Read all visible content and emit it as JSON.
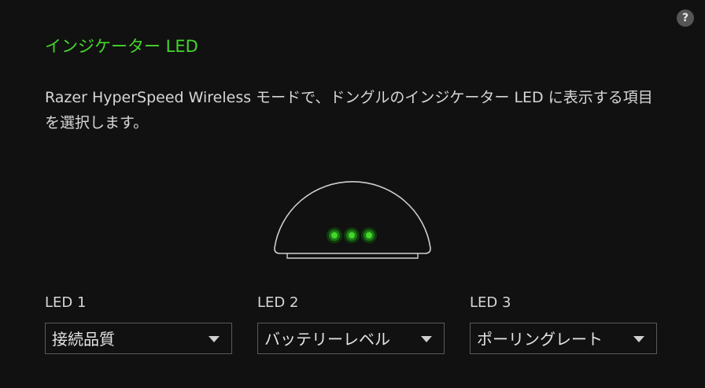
{
  "help": {
    "label": "?"
  },
  "section": {
    "title": "インジケーター LED",
    "description": "Razer HyperSpeed Wireless モードで、ドングルのインジケーター LED に表示する項目を選択します。"
  },
  "illustration": {
    "icon": "dongle-illustration",
    "led_color": "#44d62c",
    "led_count": 3
  },
  "leds": [
    {
      "label": "LED 1",
      "selected": "接続品質"
    },
    {
      "label": "LED 2",
      "selected": "バッテリーレベル"
    },
    {
      "label": "LED 3",
      "selected": "ポーリングレート"
    }
  ],
  "colors": {
    "accent": "#44d62c",
    "background": "#111111",
    "text": "#d6d6d6"
  }
}
